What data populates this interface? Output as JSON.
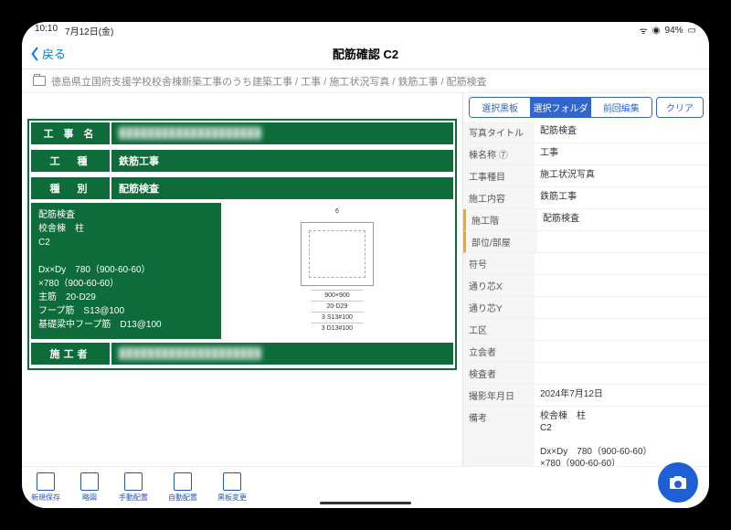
{
  "statusbar": {
    "time": "10:10",
    "date": "7月12日(金)",
    "battery": "94%"
  },
  "nav": {
    "back": "戻る",
    "title": "配筋確認  C2"
  },
  "breadcrumb": "徳島県立国府支援学校校舎棟新築工事のうち建築工事 / 工事 / 施工状況写真 / 鉄筋工事 / 配筋検査",
  "blackboard": {
    "nameLabel": "工 事 名",
    "nameVal": "████████████████████",
    "typeLabel": "工　種",
    "typeVal": "鉄筋工事",
    "kindLabel": "種　別",
    "kindVal": "配筋検査",
    "body": "配筋検査\n校舎棟　柱\nC2\n\nDx×Dy　780（900-60-60）\n×780（900-60-60）\n主筋　20-D29\nフープ筋　S13@100\n基礎梁中フープ筋　D13@100",
    "contractorLabel": "施工者",
    "contractorVal": "████████████████████",
    "diagram": {
      "dim": "900×900",
      "r1": "20-D29",
      "r2": "S13#100",
      "r3": "D13#100",
      "top": "6",
      "side": "3"
    }
  },
  "segTabs": [
    "選択黒板",
    "選択フォルダ",
    "前回編集"
  ],
  "clear": "クリア",
  "fields": [
    {
      "l": "写真タイトル",
      "v": "配筋検査"
    },
    {
      "l": "棟名称 ⑦",
      "v": "工事"
    },
    {
      "l": "工事種目",
      "v": "施工状況写真"
    },
    {
      "l": "施工内容",
      "v": "鉄筋工事"
    },
    {
      "l": "施工階",
      "v": "配筋検査",
      "orange": true
    },
    {
      "l": "部位/部屋",
      "v": "",
      "orange": true
    },
    {
      "l": "符号",
      "v": ""
    },
    {
      "l": "通り芯X",
      "v": ""
    },
    {
      "l": "通り芯Y",
      "v": ""
    },
    {
      "l": "工区",
      "v": ""
    },
    {
      "l": "立会者",
      "v": ""
    },
    {
      "l": "検査者",
      "v": ""
    },
    {
      "l": "撮影年月日",
      "v": "2024年7月12日"
    },
    {
      "l": "備考",
      "v": "校舎棟　柱\nC2\n\nDx×Dy　780（900-60-60）\n×780（900-60-60）"
    }
  ],
  "toolbar": [
    "新規保存",
    "略図",
    "手動配置",
    "自動配置",
    "黒板変更"
  ]
}
